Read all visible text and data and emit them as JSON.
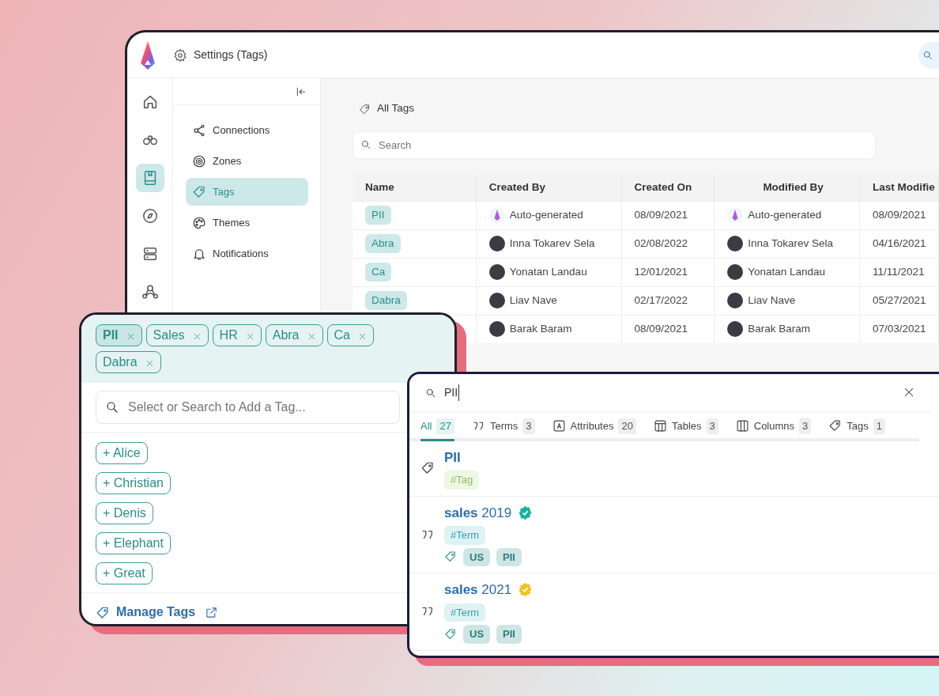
{
  "app": {
    "title": "Settings (Tags)"
  },
  "rail": [
    {
      "kind": "home",
      "selected": false
    },
    {
      "kind": "binoculars",
      "selected": false
    },
    {
      "kind": "book",
      "selected": true
    },
    {
      "kind": "compass",
      "selected": false
    },
    {
      "kind": "server",
      "selected": false
    },
    {
      "kind": "network",
      "selected": false
    }
  ],
  "settings_nav": [
    {
      "kind": "connections",
      "label": "Connections",
      "selected": false
    },
    {
      "kind": "zones",
      "label": "Zones",
      "selected": false
    },
    {
      "kind": "tags",
      "label": "Tags",
      "selected": true
    },
    {
      "kind": "themes",
      "label": "Themes",
      "selected": false
    },
    {
      "kind": "notifications",
      "label": "Notifications",
      "selected": false
    }
  ],
  "all_tags": {
    "heading": "All Tags",
    "search": {
      "placeholder": "Search"
    },
    "columns": [
      "Name",
      "Created By",
      "Created On",
      "Modified By",
      "Last Modifie"
    ],
    "rows": [
      {
        "name": "PII",
        "created_by": {
          "kind": "system",
          "name": "Auto-generated"
        },
        "created_on": "08/09/2021",
        "modified_by": {
          "kind": "system",
          "name": "Auto-generated"
        },
        "last_modified": "08/09/2021"
      },
      {
        "name": "Abra",
        "created_by": {
          "kind": "person",
          "name": "Inna Tokarev Sela"
        },
        "created_on": "02/08/2022",
        "modified_by": {
          "kind": "person",
          "name": "Inna Tokarev Sela"
        },
        "last_modified": "04/16/2021"
      },
      {
        "name": "Ca",
        "created_by": {
          "kind": "person",
          "name": "Yonatan Landau"
        },
        "created_on": "12/01/2021",
        "modified_by": {
          "kind": "person",
          "name": "Yonatan Landau"
        },
        "last_modified": "11/11/2021"
      },
      {
        "name": "Dabra",
        "created_by": {
          "kind": "person",
          "name": "Liav Nave"
        },
        "created_on": "02/17/2022",
        "modified_by": {
          "kind": "person",
          "name": "Liav Nave"
        },
        "last_modified": "05/27/2021"
      },
      {
        "created_by": {
          "kind": "person",
          "name": "Barak Baram"
        },
        "created_on": "08/09/2021",
        "modified_by": {
          "kind": "person",
          "name": "Barak Baram"
        },
        "last_modified": "07/03/2021"
      }
    ]
  },
  "tag_picker": {
    "chips": [
      {
        "label": "PII",
        "selected": true
      },
      {
        "label": "Sales",
        "selected": false
      },
      {
        "label": "HR",
        "selected": false
      },
      {
        "label": "Abra",
        "selected": false
      },
      {
        "label": "Ca",
        "selected": false
      },
      {
        "label": "Dabra",
        "selected": false
      }
    ],
    "search": {
      "placeholder": "Select or Search to Add a Tag..."
    },
    "suggestions": [
      "+ Alice",
      "+ Christian",
      "+ Denis",
      "+ Elephant",
      "+ Great"
    ],
    "footer_link": "Manage Tags"
  },
  "search_panel": {
    "query": "PII",
    "tabs": [
      {
        "kind": "all",
        "label": "All",
        "count": "27",
        "selected": true
      },
      {
        "kind": "terms",
        "label": "Terms",
        "count": "3",
        "selected": false
      },
      {
        "kind": "attributes",
        "label": "Attributes",
        "count": "20",
        "selected": false
      },
      {
        "kind": "tables",
        "label": "Tables",
        "count": "3",
        "selected": false
      },
      {
        "kind": "columns",
        "label": "Columns",
        "count": "3",
        "selected": false
      },
      {
        "kind": "tags",
        "label": "Tags",
        "count": "1",
        "selected": false
      }
    ],
    "results": [
      {
        "kind": "tag",
        "title": "PII",
        "type_label": "#Tag"
      },
      {
        "kind": "term",
        "title": "**sales** 2019",
        "color": "#14b3a3",
        "type_label": "#Term",
        "tags": [
          "US",
          "PII"
        ]
      },
      {
        "kind": "term",
        "title": "**sales** 2021",
        "color": "#f4c21b",
        "type_label": "#Term",
        "tags": [
          "US",
          "PII"
        ]
      }
    ]
  }
}
